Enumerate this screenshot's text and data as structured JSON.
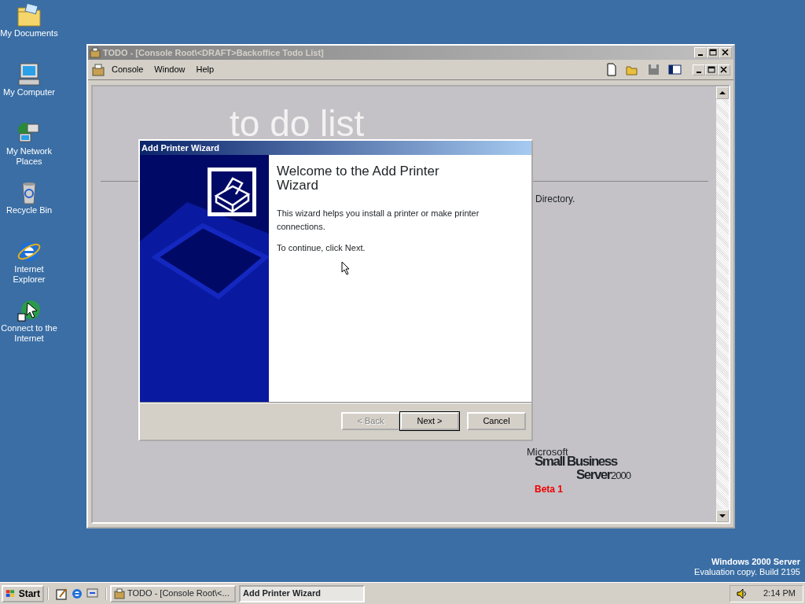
{
  "desktop_icons": [
    {
      "label": "My Documents",
      "kind": "folder"
    },
    {
      "label": "My Computer",
      "kind": "computer"
    },
    {
      "label": "My Network Places",
      "kind": "network"
    },
    {
      "label": "Recycle Bin",
      "kind": "bin"
    },
    {
      "label": "Internet Explorer",
      "kind": "browser"
    },
    {
      "label": "Connect to the Internet",
      "kind": "connect"
    }
  ],
  "console_window": {
    "title": "TODO - [Console Root\\<DRAFT>Backoffice Todo List]",
    "menu": [
      "Console",
      "Window",
      "Help"
    ],
    "content": {
      "heading": "to do list",
      "fragment": "Directory.",
      "logo": {
        "brand": "Microsoft",
        "line1": "Small Business",
        "line2": "Server",
        "year": "2000",
        "beta": "Beta 1"
      }
    }
  },
  "wizard": {
    "title": "Add Printer Wizard",
    "heading": "Welcome to the Add Printer Wizard",
    "paragraphs": [
      "This wizard helps you install a printer or make printer connections.",
      "To continue, click Next."
    ],
    "buttons": [
      {
        "label": "< Back",
        "disabled": true,
        "default": false
      },
      {
        "label": "Next >",
        "disabled": false,
        "default": true
      },
      {
        "label": "Cancel",
        "disabled": false,
        "default": false
      }
    ]
  },
  "desktop_note": {
    "line1": "Windows 2000 Server",
    "line2": "Evaluation copy. Build 2195"
  },
  "taskbar": {
    "start": "Start",
    "tasks": [
      {
        "label": "TODO - [Console Root\\<...",
        "selected": false
      },
      {
        "label": "Add Printer Wizard",
        "selected": true
      }
    ],
    "clock": "2:14 PM"
  }
}
